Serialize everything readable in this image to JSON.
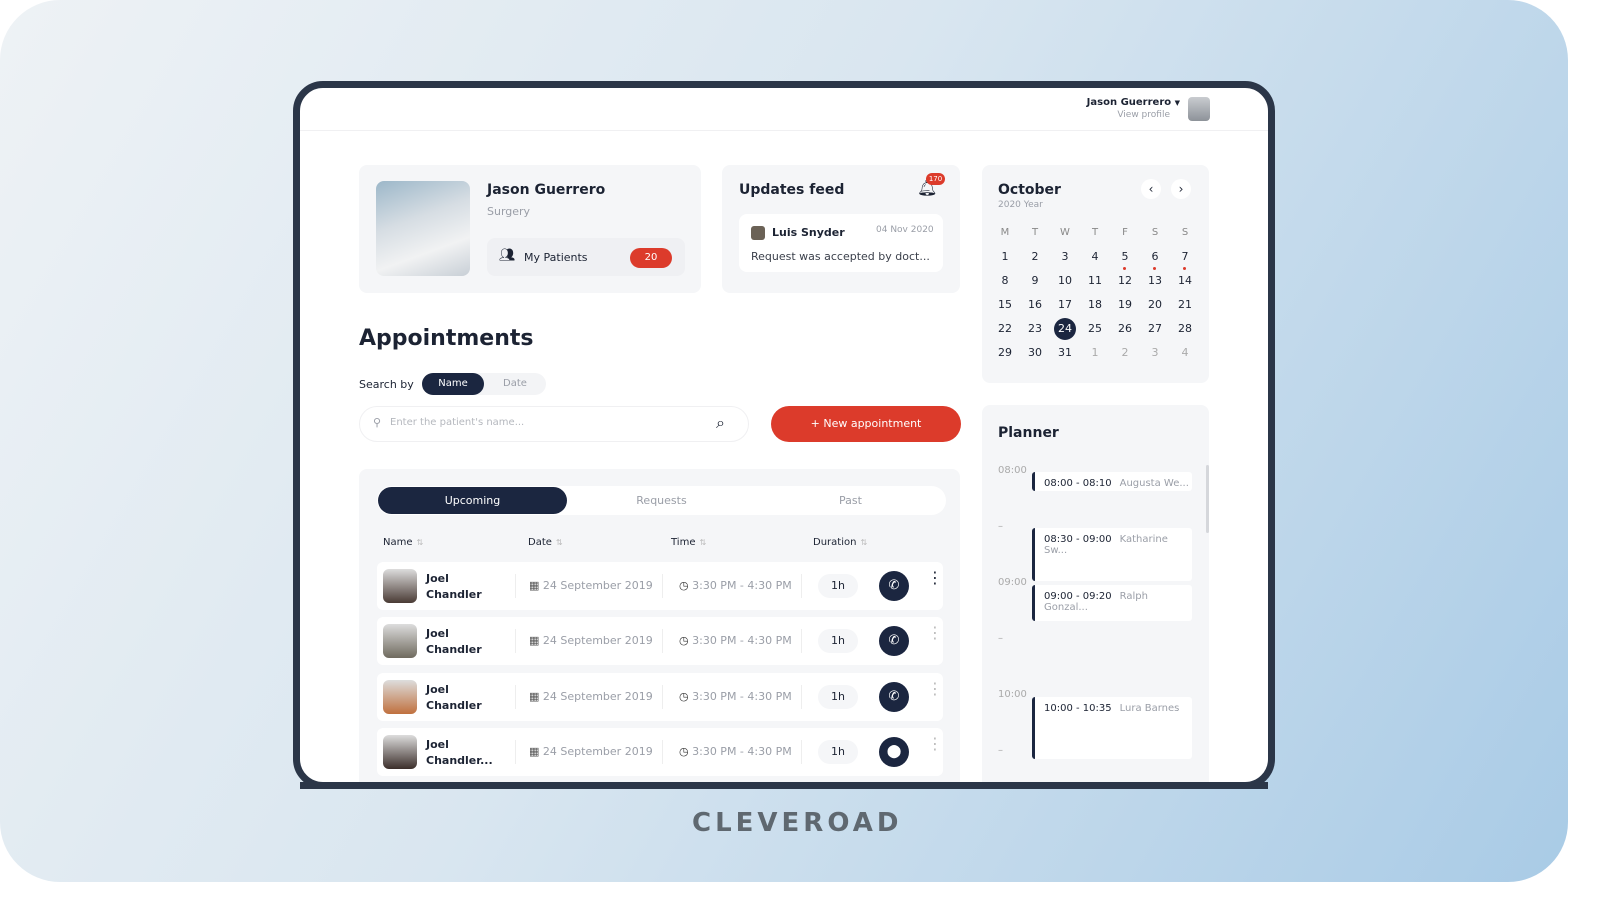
{
  "header": {
    "user_name": "Jason Guerrero",
    "view_profile": "View profile"
  },
  "profile": {
    "name": "Jason Guerrero",
    "department": "Surgery",
    "patients_label": "My Patients",
    "patients_count": "20"
  },
  "updates": {
    "title": "Updates feed",
    "notification_count": "170",
    "item": {
      "author": "Luis Snyder",
      "date": "04 Nov 2020",
      "text": "Request was accepted  by doct..."
    }
  },
  "calendar": {
    "month": "October",
    "year": "2020 Year",
    "weekdays": [
      "M",
      "T",
      "W",
      "T",
      "F",
      "S",
      "S"
    ],
    "days": [
      [
        "1",
        ""
      ],
      [
        "2",
        ""
      ],
      [
        "3",
        ""
      ],
      [
        "4",
        ""
      ],
      [
        "5",
        "dot"
      ],
      [
        "6",
        "dot"
      ],
      [
        "7",
        "dot"
      ],
      [
        "8",
        ""
      ],
      [
        "9",
        ""
      ],
      [
        "10",
        ""
      ],
      [
        "11",
        ""
      ],
      [
        "12",
        ""
      ],
      [
        "13",
        ""
      ],
      [
        "14",
        ""
      ],
      [
        "15",
        ""
      ],
      [
        "16",
        ""
      ],
      [
        "17",
        ""
      ],
      [
        "18",
        ""
      ],
      [
        "19",
        ""
      ],
      [
        "20",
        ""
      ],
      [
        "21",
        ""
      ],
      [
        "22",
        ""
      ],
      [
        "23",
        ""
      ],
      [
        "24",
        "sel"
      ],
      [
        "25",
        ""
      ],
      [
        "26",
        ""
      ],
      [
        "27",
        ""
      ],
      [
        "28",
        ""
      ],
      [
        "29",
        ""
      ],
      [
        "30",
        ""
      ],
      [
        "31",
        ""
      ],
      [
        "1",
        "dim"
      ],
      [
        "2",
        "dim"
      ],
      [
        "3",
        "dim"
      ],
      [
        "4",
        "dim"
      ]
    ]
  },
  "appointments": {
    "title": "Appointments",
    "search_by": "Search by",
    "filter_name": "Name",
    "filter_date": "Date",
    "search_placeholder": "Enter the patient's name...",
    "new_button": "+ New appointment",
    "tabs": [
      "Upcoming",
      "Requests",
      "Past"
    ],
    "columns": [
      "Name",
      "Date",
      "Time",
      "Duration"
    ],
    "rows": [
      {
        "name1": "Joel",
        "name2": "Chandler",
        "date": "24 September 2019",
        "time": "3:30 PM - 4:30 PM",
        "duration": "1h",
        "action": "phone"
      },
      {
        "name1": "Joel",
        "name2": "Chandler",
        "date": "24 September 2019",
        "time": "3:30 PM - 4:30 PM",
        "duration": "1h",
        "action": "phone"
      },
      {
        "name1": "Joel",
        "name2": "Chandler",
        "date": "24 September 2019",
        "time": "3:30 PM - 4:30 PM",
        "duration": "1h",
        "action": "phone"
      },
      {
        "name1": "Joel",
        "name2": "Chandler...",
        "date": "24 September 2019",
        "time": "3:30 PM - 4:30 PM",
        "duration": "1h",
        "action": "location"
      }
    ]
  },
  "planner": {
    "title": "Planner",
    "hours": [
      "08:00",
      "–",
      "09:00",
      "–",
      "10:00",
      "–"
    ],
    "events": [
      {
        "time": "08:00 - 08:10",
        "name": "Augusta We..."
      },
      {
        "time": "08:30 - 09:00",
        "name": "Katharine Sw..."
      },
      {
        "time": "09:00 - 09:20",
        "name": "Ralph Gonzal..."
      },
      {
        "time": "10:00 - 10:35",
        "name": "Lura Barnes"
      }
    ]
  },
  "brand": "CLEVEROAD",
  "colors": {
    "accent": "#dc3b2b",
    "navy": "#1b2640"
  }
}
